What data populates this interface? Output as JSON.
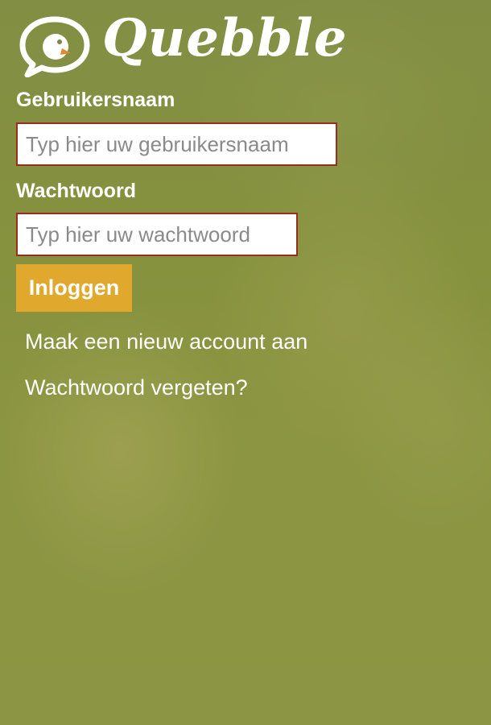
{
  "app": {
    "brand": "Quebble",
    "logo_icon": "speech-bubble-chick-icon"
  },
  "colors": {
    "overlay": "#7b8a44",
    "button": "#e0a92e",
    "field_border": "#9a2d22",
    "text": "#ffffff"
  },
  "login": {
    "username_label": "Gebruikersnaam",
    "username_placeholder": "Typ hier uw gebruikersnaam",
    "username_value": "",
    "password_label": "Wachtwoord",
    "password_placeholder": "Typ hier uw wachtwoord",
    "password_value": "",
    "login_button": "Inloggen",
    "create_account_link": "Maak een nieuw account aan",
    "forgot_password_link": "Wachtwoord vergeten?"
  }
}
